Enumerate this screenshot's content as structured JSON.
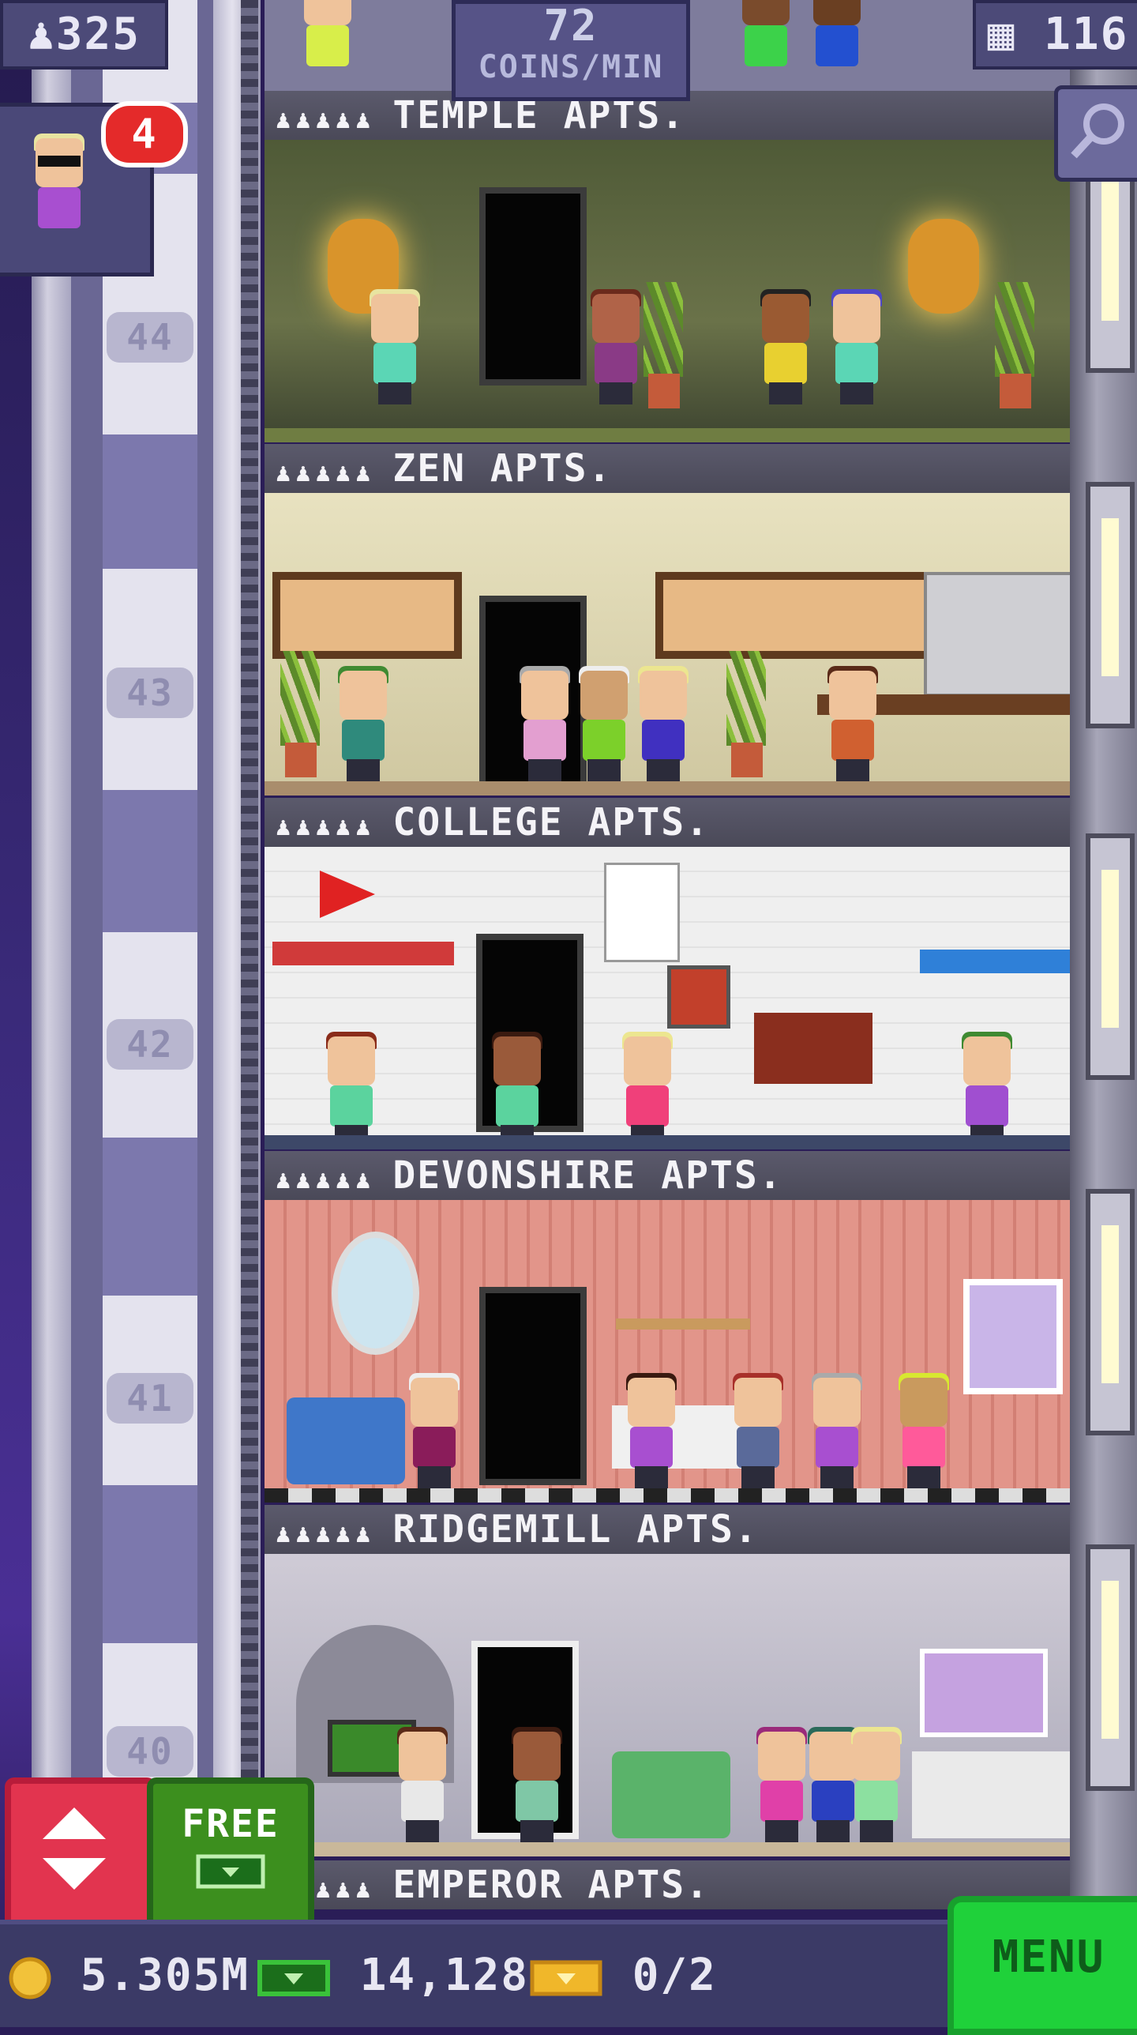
{
  "header": {
    "population": "325",
    "coins_rate_value": "72",
    "coins_rate_unit": "COINS/MIN",
    "floor_count": "116"
  },
  "vip": {
    "notification_count": "4"
  },
  "floor_numbers": [
    "44",
    "43",
    "42",
    "41",
    "40"
  ],
  "floors": [
    {
      "name": "TEMPLE APTS.",
      "residents": 5
    },
    {
      "name": "ZEN APTS.",
      "residents": 5
    },
    {
      "name": "COLLEGE APTS.",
      "residents": 5
    },
    {
      "name": "DEVONSHIRE APTS.",
      "residents": 5
    },
    {
      "name": "RIDGEMILL APTS.",
      "residents": 5
    },
    {
      "name": "EMPEROR APTS.",
      "residents": 5
    }
  ],
  "buttons": {
    "free_label": "FREE",
    "menu_label": "MENU"
  },
  "currency": {
    "coins": "5.305M",
    "bux": "14,128",
    "tickets": "0/2"
  },
  "icons": {
    "population": "person-icon",
    "floors": "building-icon",
    "search": "magnifier-icon",
    "elevator": "up-down-arrow-icon",
    "coin": "coin-icon",
    "bux": "bux-icon",
    "ticket": "golden-ticket-icon"
  },
  "colors": {
    "menu_green": "#1fd13a",
    "elevator_red": "#e2344f",
    "free_green": "#3c8f1e",
    "notification_red": "#e42a2a"
  }
}
